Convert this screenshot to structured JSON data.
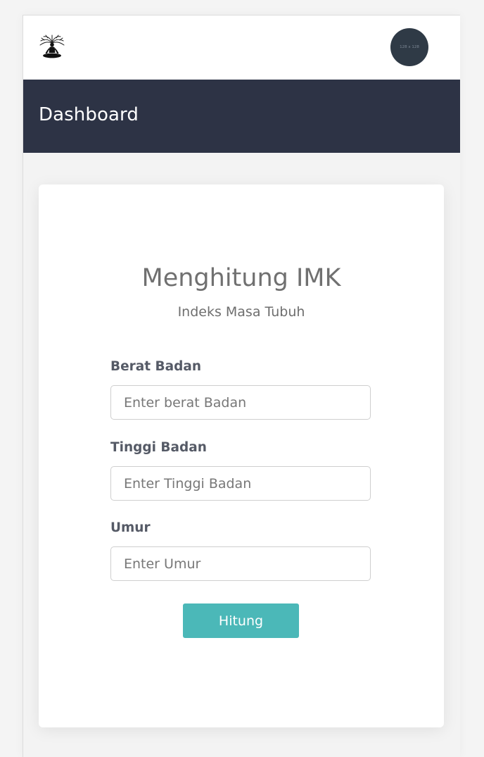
{
  "header": {
    "logo_icon": "meditation-tree-icon",
    "avatar_text": "128 x 128",
    "page_title": "Dashboard"
  },
  "form": {
    "title": "Menghitung IMK",
    "subtitle": "Indeks Masa Tubuh",
    "fields": [
      {
        "label": "Berat Badan",
        "placeholder": "Enter berat Badan",
        "value": ""
      },
      {
        "label": "Tinggi Badan",
        "placeholder": "Enter Tinggi Badan",
        "value": ""
      },
      {
        "label": "Umur",
        "placeholder": "Enter Umur",
        "value": ""
      }
    ],
    "submit_label": "Hitung"
  },
  "colors": {
    "header_band": "#2d3345",
    "button": "#4bb8b8",
    "avatar": "#2f3a46"
  }
}
